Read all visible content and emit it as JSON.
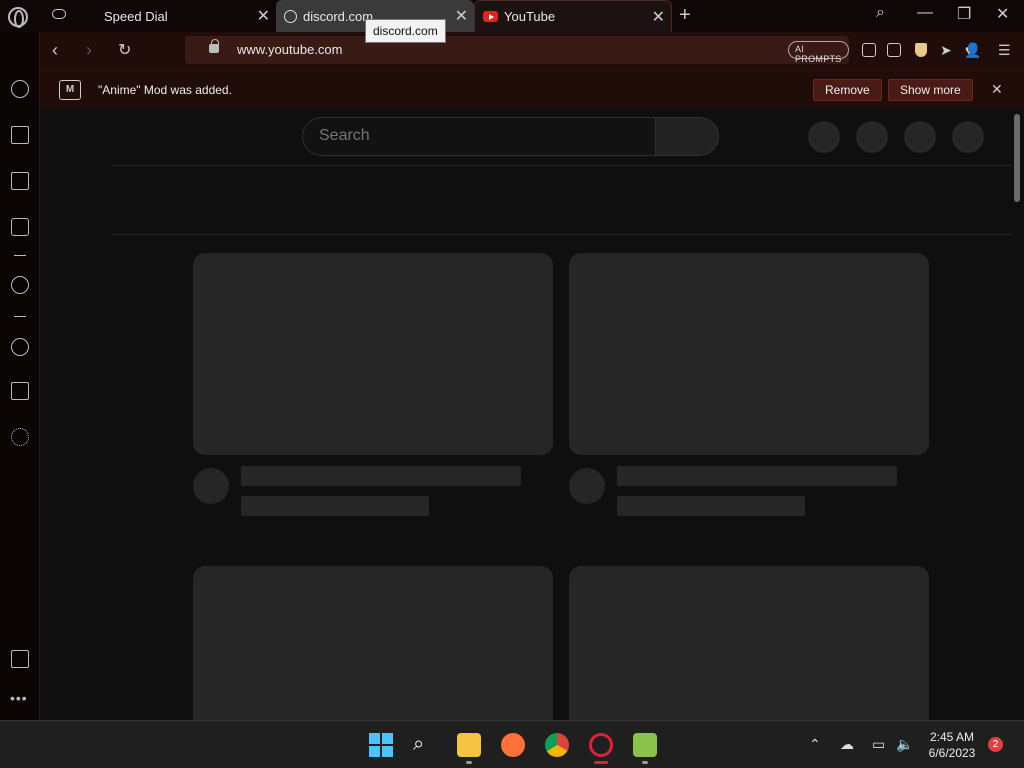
{
  "tabs": [
    {
      "label": "Speed Dial",
      "icon": "speed-dial-grid-icon"
    },
    {
      "label": "discord.com",
      "icon": "globe-icon"
    },
    {
      "label": "YouTube",
      "icon": "youtube-icon"
    }
  ],
  "tooltip": "discord.com",
  "address_bar": {
    "url": "www.youtube.com",
    "ai_prompts_label": "AI PROMPTS"
  },
  "notification": {
    "text": "\"Anime\" Mod was added.",
    "remove_label": "Remove",
    "show_more_label": "Show more",
    "mod_icon_letter": "M"
  },
  "youtube": {
    "search_placeholder": "Search"
  },
  "taskbar": {
    "time": "2:45 AM",
    "date": "6/6/2023",
    "notification_count": "2"
  },
  "colors": {
    "accent_gold": "#e8c98a",
    "youtube_red": "#e62117",
    "windows_blue": "#4cc2ff"
  }
}
